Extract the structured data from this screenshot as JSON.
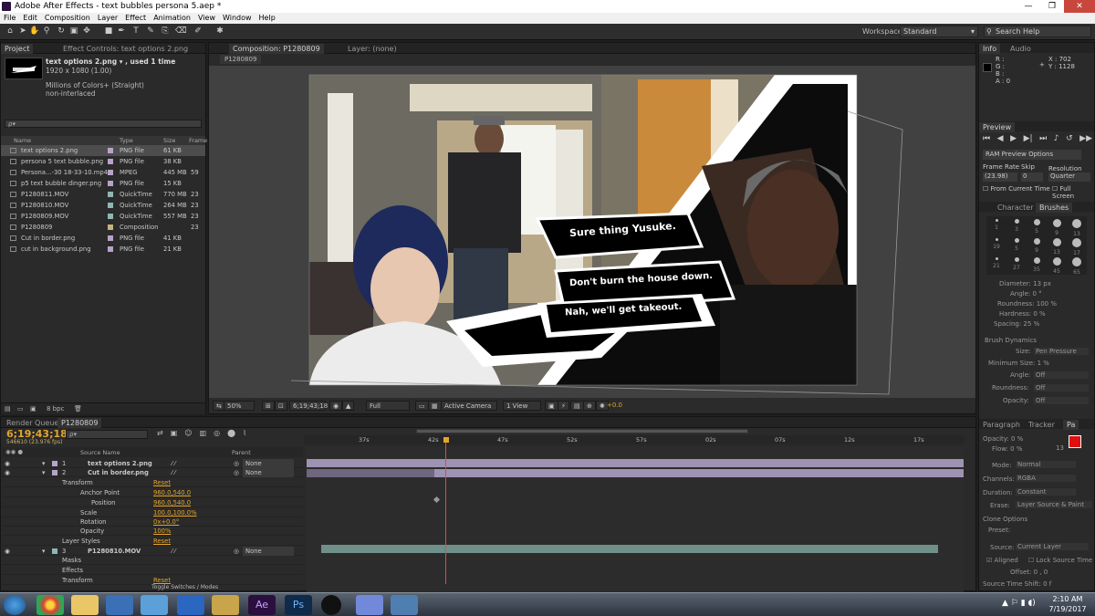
{
  "window": {
    "title": "Adobe After Effects - text bubbles persona 5.aep *",
    "minimize": "—",
    "maximize": "❐",
    "close": "✕"
  },
  "menu": [
    "File",
    "Edit",
    "Composition",
    "Layer",
    "Effect",
    "Animation",
    "View",
    "Window",
    "Help"
  ],
  "toolbar": {
    "workspace_label": "Workspace:",
    "workspace_value": "Standard",
    "search_placeholder": "Search Help"
  },
  "project": {
    "tabs": [
      "Project",
      "Effect Controls: text options 2.png"
    ],
    "selected_name": "text options 2.png ▾ , used 1 time",
    "dims": "1920 x 1080 (1.00)",
    "colors": "Millions of Colors+ (Straight)",
    "interlace": "non-interlaced",
    "search_placeholder": "ρ▾",
    "columns": [
      "Name",
      "Type",
      "Size",
      "Frame"
    ],
    "items": [
      {
        "name": "text options 2.png",
        "type": "PNG file",
        "size": "61 KB",
        "frame": "",
        "color": "#b8a3c8",
        "sel": true
      },
      {
        "name": "persona 5 text bubble.png",
        "type": "PNG file",
        "size": "38 KB",
        "frame": "",
        "color": "#b8a3c8"
      },
      {
        "name": "Persona...-30 18-33-10.mp4",
        "type": "MPEG",
        "size": "445 MB",
        "frame": "59",
        "color": "#b8a3c8"
      },
      {
        "name": "p5 text bubble dinger.png",
        "type": "PNG file",
        "size": "15 KB",
        "frame": "",
        "color": "#b8a3c8"
      },
      {
        "name": "P1280811.MOV",
        "type": "QuickTime",
        "size": "770 MB",
        "frame": "23",
        "color": "#8fb6b2"
      },
      {
        "name": "P1280810.MOV",
        "type": "QuickTime",
        "size": "264 MB",
        "frame": "23",
        "color": "#8fb6b2"
      },
      {
        "name": "P1280809.MOV",
        "type": "QuickTime",
        "size": "557 MB",
        "frame": "23",
        "color": "#8fb6b2"
      },
      {
        "name": "P1280809",
        "type": "Composition",
        "size": "",
        "frame": "23",
        "color": "#c5b27e"
      },
      {
        "name": "Cut in border.png",
        "type": "PNG file",
        "size": "41 KB",
        "frame": "",
        "color": "#b8a3c8"
      },
      {
        "name": "cut in background.png",
        "type": "PNG file",
        "size": "21 KB",
        "frame": "",
        "color": "#b8a3c8"
      }
    ],
    "bpc": "8 bpc"
  },
  "comp": {
    "tabs": [
      "Composition: P1280809",
      "Layer: (none)"
    ],
    "sub_tab": "P1280809",
    "bubbles": [
      "Sure thing Yusuke.",
      "Don't burn the house down.",
      "Nah, we'll get takeout."
    ],
    "bar": {
      "zoom": "50%",
      "timecode": "6;19;43;18",
      "resolution": "Full",
      "camera": "Active Camera",
      "view": "1 View",
      "exposure": "+0.0"
    }
  },
  "info": {
    "tabs": [
      "Info",
      "Audio"
    ],
    "r": "R :",
    "g": "G :",
    "b": "B :",
    "a": "A : 0",
    "x": "X : 702",
    "y": "Y : 1128"
  },
  "preview": {
    "tab": "Preview",
    "ram": "RAM Preview Options",
    "framerate_label": "Frame Rate",
    "skip_label": "Skip",
    "res_label": "Resolution",
    "framerate": "(23.98)",
    "skip": "0",
    "res": "Quarter",
    "from_current": "From Current Time",
    "full_screen": "Full Screen"
  },
  "brushes": {
    "tabs": [
      "Character",
      "Brushes"
    ],
    "sizes": [
      "1",
      "3",
      "5",
      "9",
      "13",
      "19",
      "5",
      "9",
      "13",
      "17",
      "21",
      "27",
      "35",
      "45",
      "65"
    ],
    "diameter": "Diameter: 13 px",
    "angle": "Angle: 0 °",
    "roundness": "Roundness: 100 %",
    "hardness": "Hardness: 0 %",
    "spacing": "Spacing: 25 %",
    "dynamics": "Brush Dynamics",
    "size": "Size:",
    "size_val": "Pen Pressure",
    "minsize": "Minimum Size: 1 %",
    "angle2": "Angle:",
    "off1": "Off",
    "round2": "Roundness:",
    "off2": "Off",
    "opacity": "Opacity:",
    "off3": "Off"
  },
  "paint": {
    "tabs": [
      "Paragraph",
      "Tracker",
      "Pa"
    ],
    "opacity": "Opacity: 0 %",
    "flow": "Flow: 0 %",
    "mode_label": "Mode:",
    "mode": "Normal",
    "channels_label": "Channels:",
    "channels": "RGBA",
    "duration_label": "Duration:",
    "duration": "Constant",
    "erase_label": "Erase:",
    "erase": "Layer Source & Paint",
    "clone": "Clone Options",
    "preset": "Preset:",
    "source_label": "Source:",
    "source": "Current Layer",
    "aligned": "Aligned",
    "lock": "Lock Source Time",
    "offset": "Offset: 0 , 0",
    "sts": "Source Time Shift: 0 f",
    "brush_size": "13"
  },
  "timeline": {
    "tabs": [
      "Render Queue",
      "P1280809"
    ],
    "timecode": "6;19;43;18",
    "frames": "546610 (23.976 fps)",
    "search_placeholder": "ρ▾",
    "col_source": "Source Name",
    "col_parent": "Parent",
    "ruler": [
      "37s",
      "42s",
      "47s",
      "52s",
      "57s",
      "02s",
      "07s",
      "12s",
      "17s"
    ],
    "layers": [
      {
        "num": "1",
        "name": "text options 2.png",
        "parent": "None"
      },
      {
        "num": "2",
        "name": "Cut in border.png",
        "parent": "None"
      },
      {
        "num": "3",
        "name": "P1280810.MOV",
        "parent": "None"
      }
    ],
    "props": {
      "transform": "Transform",
      "reset": "Reset",
      "anchor": "Anchor Point",
      "anchor_val": "960.0,540.0",
      "position": "Position",
      "position_val": "960.0,540.0",
      "scale": "Scale",
      "scale_val": "100.0,100.0%",
      "rotation": "Rotation",
      "rotation_val": "0x+0.0°",
      "opacity": "Opacity",
      "opacity_val": "100%",
      "layer_styles": "Layer Styles",
      "masks": "Masks",
      "effects": "Effects",
      "transform2": "Transform"
    },
    "toggle": "Toggle Switches / Modes"
  },
  "taskbar": {
    "time": "2:10 AM",
    "date": "7/19/2017"
  }
}
